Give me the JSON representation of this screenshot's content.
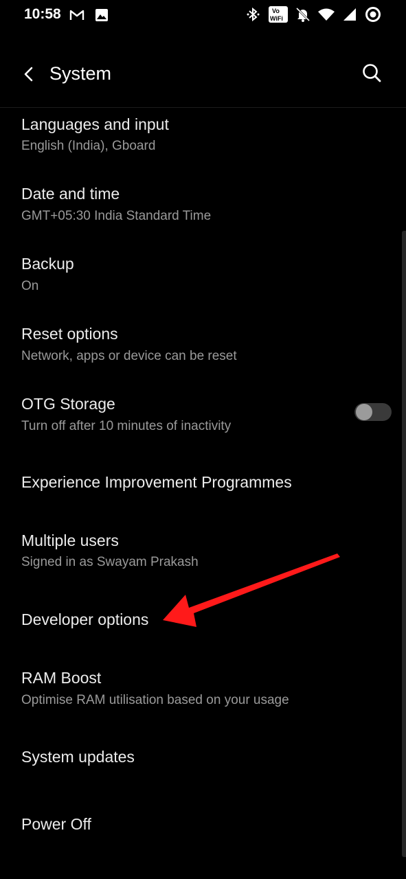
{
  "status_bar": {
    "time": "10:58",
    "left_icons": [
      "gmail-icon",
      "gallery-icon"
    ],
    "right_icons": [
      "bluetooth-icon",
      "vowifi-icon",
      "mute-icon",
      "wifi-icon",
      "signal-icon",
      "battery-icon"
    ],
    "vowifi_top": "Vo",
    "vowifi_bottom": "WiFi"
  },
  "app_bar": {
    "title": "System"
  },
  "items": [
    {
      "title": "Languages and input",
      "summary": "English (India), Gboard"
    },
    {
      "title": "Date and time",
      "summary": "GMT+05:30 India Standard Time"
    },
    {
      "title": "Backup",
      "summary": "On"
    },
    {
      "title": "Reset options",
      "summary": "Network, apps or device can be reset"
    },
    {
      "title": "OTG Storage",
      "summary": "Turn off after 10 minutes of inactivity",
      "toggle": false
    },
    {
      "title": "Experience Improvement Programmes"
    },
    {
      "title": "Multiple users",
      "summary": "Signed in as Swayam Prakash"
    },
    {
      "title": "Developer options"
    },
    {
      "title": "RAM Boost",
      "summary": "Optimise RAM utilisation based on your usage"
    },
    {
      "title": "System updates"
    },
    {
      "title": "Power Off"
    }
  ],
  "colors": {
    "background": "#000000",
    "text_primary": "#ececec",
    "text_secondary": "#9a9a9a",
    "annotation_arrow": "#ff1a1a"
  }
}
